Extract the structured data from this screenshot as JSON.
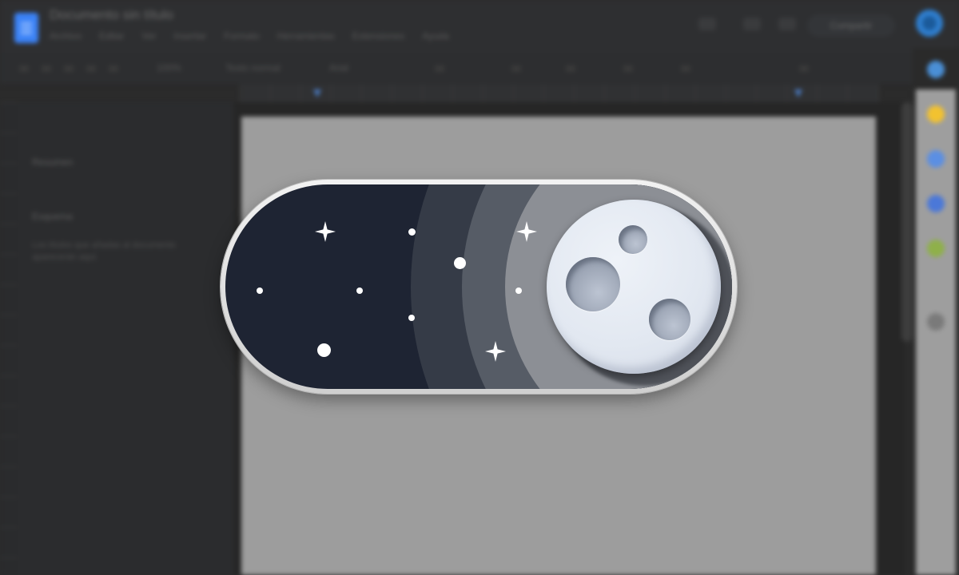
{
  "app": {
    "doc_title": "Documento sin título",
    "menu": [
      "Archivo",
      "Editar",
      "Ver",
      "Insertar",
      "Formato",
      "Herramientas",
      "Extensiones",
      "Ayuda"
    ],
    "share_label": "Compartir",
    "toolbar": {
      "zoom": "100%",
      "style": "Texto normal",
      "font": "Arial"
    },
    "sidebar": {
      "heading_1": "Resumen",
      "heading_2": "Esquema",
      "note": "Los títulos que añadas al documento aparecerán aquí."
    }
  },
  "toggle": {
    "state": "dark-mode-on",
    "colors": {
      "sky": "#1e2433",
      "ring_1": "#353b47",
      "ring_2": "#565c66",
      "ring_3": "#8c8f95",
      "moon": "#e2e8f1",
      "frame": "#e6e6e6"
    },
    "icons": [
      "moon-icon",
      "star-icon",
      "sparkle-icon"
    ]
  }
}
